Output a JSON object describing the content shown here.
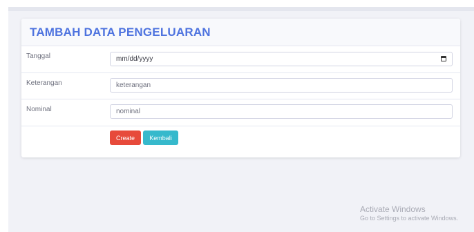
{
  "form": {
    "title": "TAMBAH DATA PENGELUARAN",
    "fields": [
      {
        "label": "Tanggal",
        "placeholder": "mm/dd/yyyy"
      },
      {
        "label": "Keterangan",
        "placeholder": "keterangan"
      },
      {
        "label": "Nominal",
        "placeholder": "nominal"
      }
    ],
    "buttons": {
      "create": "Create",
      "back": "Kembali"
    }
  },
  "watermark": {
    "title": "Activate Windows",
    "subtitle": "Go to Settings to activate Windows."
  },
  "colors": {
    "title": "#4e73df",
    "create_button": "#e74a3b",
    "back_button": "#36b9cc",
    "page_background": "#f1f2f7"
  },
  "icons": {
    "date_field": "calendar-icon"
  }
}
